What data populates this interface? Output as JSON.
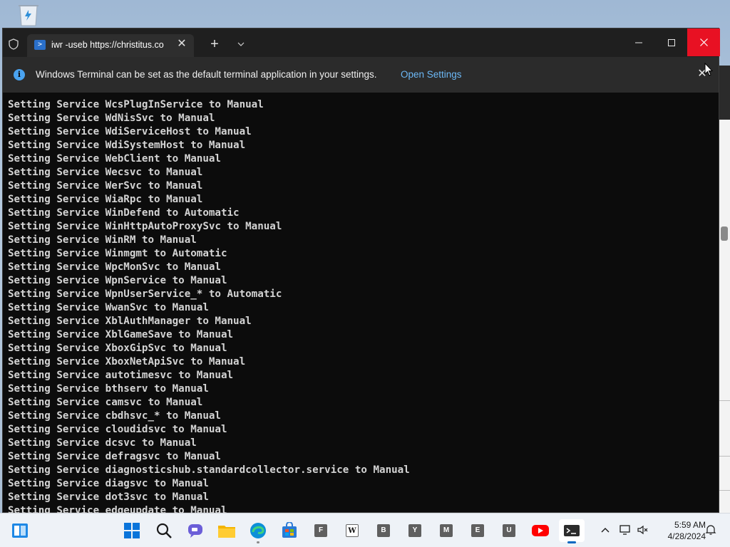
{
  "desktop": {
    "recycle_bin_icon": "recycle-bin-icon"
  },
  "terminal": {
    "tab_title": "iwr -useb https://christitus.co",
    "tab_icon": "powershell-icon",
    "infobar": {
      "message": "Windows Terminal can be set as the default terminal application in your settings.",
      "link": "Open Settings"
    },
    "console_lines": [
      "Setting Service WcsPlugInService to Manual",
      "Setting Service WdNisSvc to Manual",
      "Setting Service WdiServiceHost to Manual",
      "Setting Service WdiSystemHost to Manual",
      "Setting Service WebClient to Manual",
      "Setting Service Wecsvc to Manual",
      "Setting Service WerSvc to Manual",
      "Setting Service WiaRpc to Manual",
      "Setting Service WinDefend to Automatic",
      "Setting Service WinHttpAutoProxySvc to Manual",
      "Setting Service WinRM to Manual",
      "Setting Service Winmgmt to Automatic",
      "Setting Service WpcMonSvc to Manual",
      "Setting Service WpnService to Manual",
      "Setting Service WpnUserService_* to Automatic",
      "Setting Service WwanSvc to Manual",
      "Setting Service XblAuthManager to Manual",
      "Setting Service XblGameSave to Manual",
      "Setting Service XboxGipSvc to Manual",
      "Setting Service XboxNetApiSvc to Manual",
      "Setting Service autotimesvc to Manual",
      "Setting Service bthserv to Manual",
      "Setting Service camsvc to Manual",
      "Setting Service cbdhsvc_* to Manual",
      "Setting Service cloudidsvc to Manual",
      "Setting Service dcsvc to Manual",
      "Setting Service defragsvc to Manual",
      "Setting Service diagnosticshub.standardcollector.service to Manual",
      "Setting Service diagsvc to Manual",
      "Setting Service dot3svc to Manual",
      "Setting Service edgeupdate to Manual"
    ]
  },
  "taskbar": {
    "items": [
      {
        "name": "widgets-icon"
      },
      {
        "name": "start-icon"
      },
      {
        "name": "search-icon"
      },
      {
        "name": "teams-chat-icon"
      },
      {
        "name": "file-explorer-icon"
      },
      {
        "name": "edge-icon"
      },
      {
        "name": "store-icon"
      },
      {
        "name": "app-f",
        "letter": "F"
      },
      {
        "name": "wikipedia-icon",
        "letter": "W"
      },
      {
        "name": "app-b",
        "letter": "B"
      },
      {
        "name": "app-y",
        "letter": "Y"
      },
      {
        "name": "app-m",
        "letter": "M"
      },
      {
        "name": "app-e",
        "letter": "E"
      },
      {
        "name": "app-u",
        "letter": "U"
      },
      {
        "name": "youtube-icon"
      },
      {
        "name": "terminal-icon"
      }
    ],
    "tray": {
      "chevron": "chevron-up-icon",
      "network": "network-icon",
      "volume": "volume-muted-icon",
      "notification": "notification-icon"
    },
    "time": "5:59 AM",
    "date": "4/28/2024"
  },
  "colors": {
    "terminal_bg": "#0c0c0c",
    "close_red": "#e81123",
    "link_blue": "#6cb8f6",
    "accent": "#0067c0"
  }
}
